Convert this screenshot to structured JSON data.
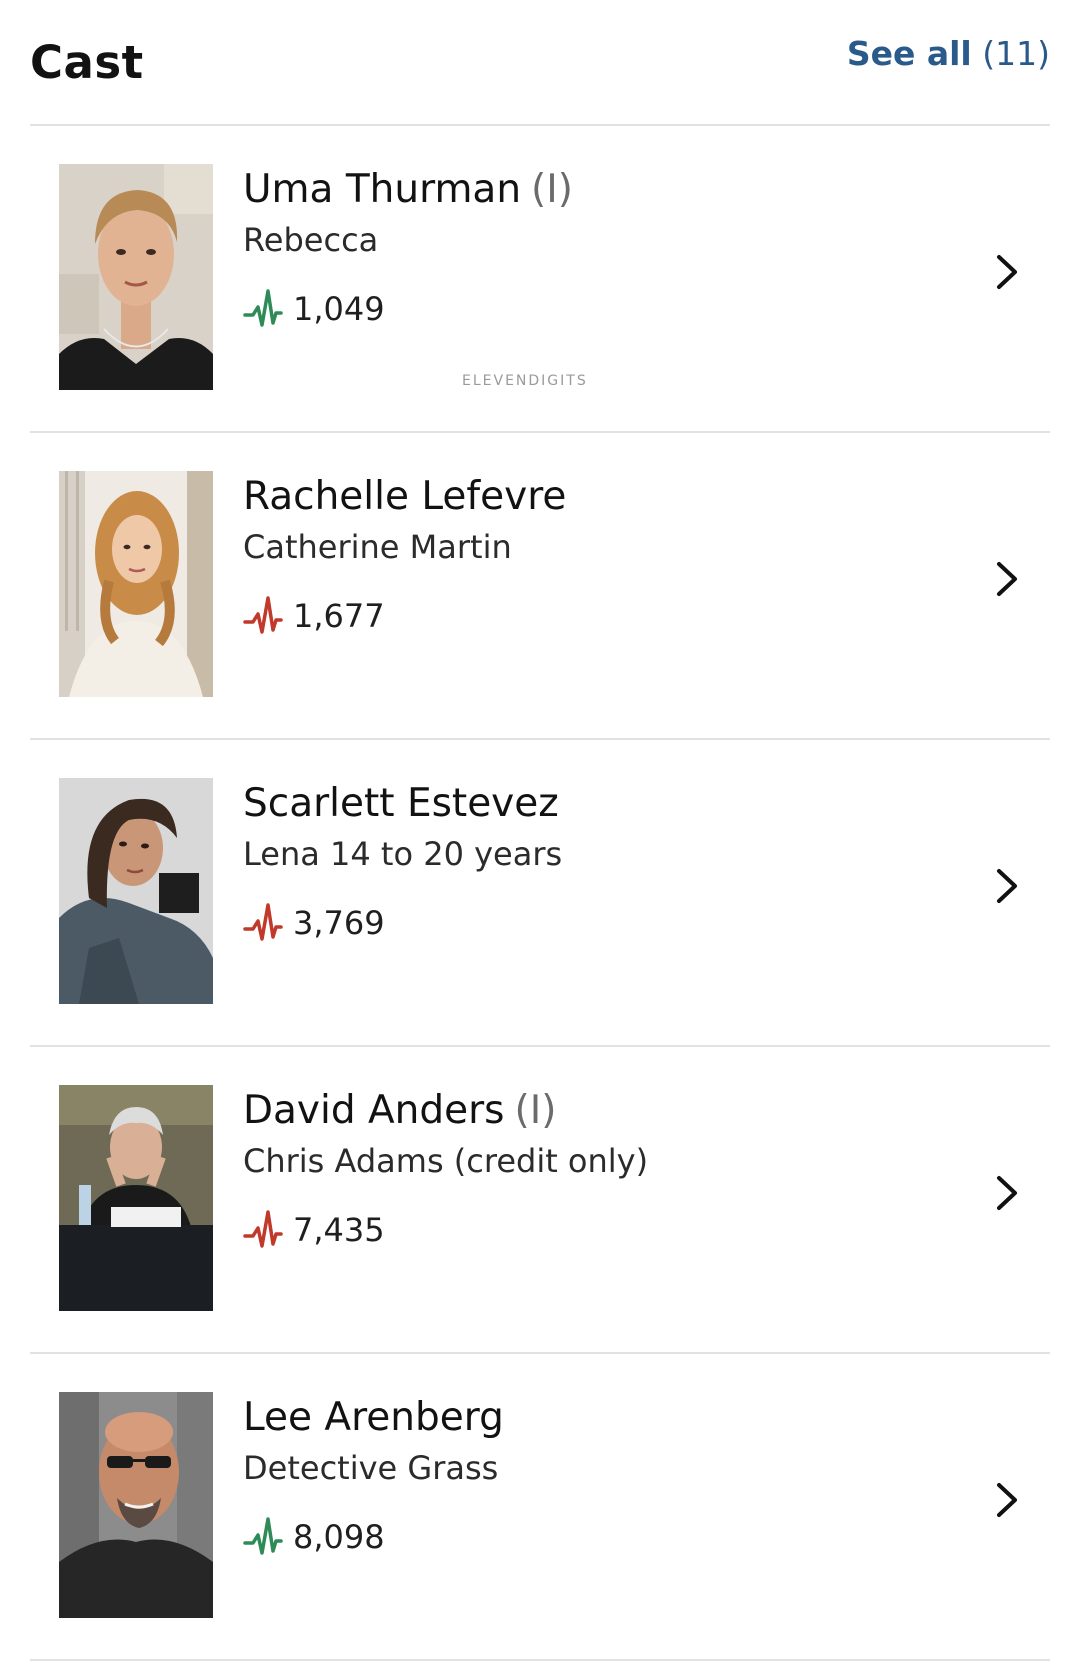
{
  "header": {
    "title": "Cast",
    "see_all_label": "See all",
    "see_all_count": "(11)"
  },
  "watermark": "ELEVENDIGITS",
  "colors": {
    "link": "#2a5a8c",
    "meter_up": "#2e8b57",
    "meter_down": "#c0392b",
    "divider": "#e2e2e2"
  },
  "cast": [
    {
      "name": "Uma Thurman",
      "qualifier": "(I)",
      "character": "Rebecca",
      "starmeter": "1,049",
      "trend": "up",
      "trend_icon": "starmeter-up-icon"
    },
    {
      "name": "Rachelle Lefevre",
      "qualifier": "",
      "character": "Catherine Martin",
      "starmeter": "1,677",
      "trend": "down",
      "trend_icon": "starmeter-down-icon"
    },
    {
      "name": "Scarlett Estevez",
      "qualifier": "",
      "character": "Lena 14 to 20 years",
      "starmeter": "3,769",
      "trend": "down",
      "trend_icon": "starmeter-down-icon"
    },
    {
      "name": "David Anders",
      "qualifier": "(I)",
      "character": "Chris Adams (credit only)",
      "starmeter": "7,435",
      "trend": "down",
      "trend_icon": "starmeter-down-icon"
    },
    {
      "name": "Lee Arenberg",
      "qualifier": "",
      "character": "Detective Grass",
      "starmeter": "8,098",
      "trend": "up",
      "trend_icon": "starmeter-up-icon"
    }
  ]
}
